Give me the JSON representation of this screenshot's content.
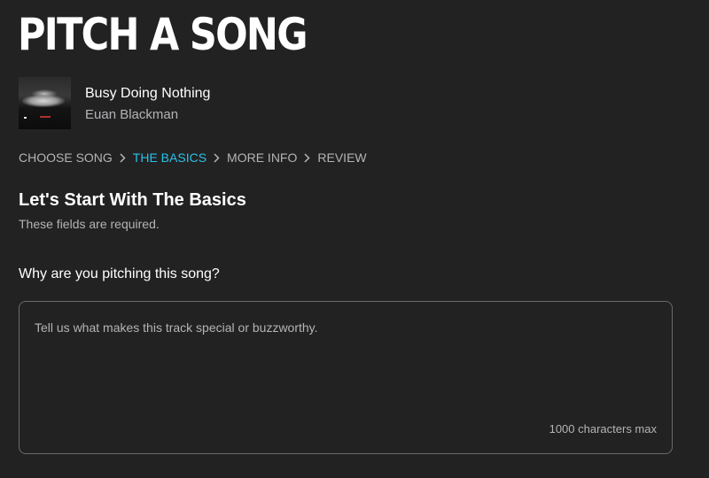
{
  "header": {
    "title": "PITCH A SONG"
  },
  "song": {
    "title": "Busy Doing Nothing",
    "artist": "Euan Blackman"
  },
  "breadcrumb": {
    "steps": [
      {
        "label": "CHOOSE SONG",
        "active": false
      },
      {
        "label": "THE BASICS",
        "active": true
      },
      {
        "label": "MORE INFO",
        "active": false
      },
      {
        "label": "REVIEW",
        "active": false
      }
    ]
  },
  "section": {
    "title": "Let's Start With The Basics",
    "note": "These fields are required."
  },
  "pitch_field": {
    "label": "Why are you pitching this song?",
    "placeholder": "Tell us what makes this track special or buzzworthy.",
    "value": "",
    "limit_text": "1000 characters max"
  },
  "colors": {
    "background": "#222223",
    "accent": "#28c2e8",
    "muted_text": "#b4b4b6",
    "border": "#6a6a6c"
  },
  "icons": {
    "breadcrumb_separator": "chevron-right-icon",
    "cover": "album-cover"
  }
}
